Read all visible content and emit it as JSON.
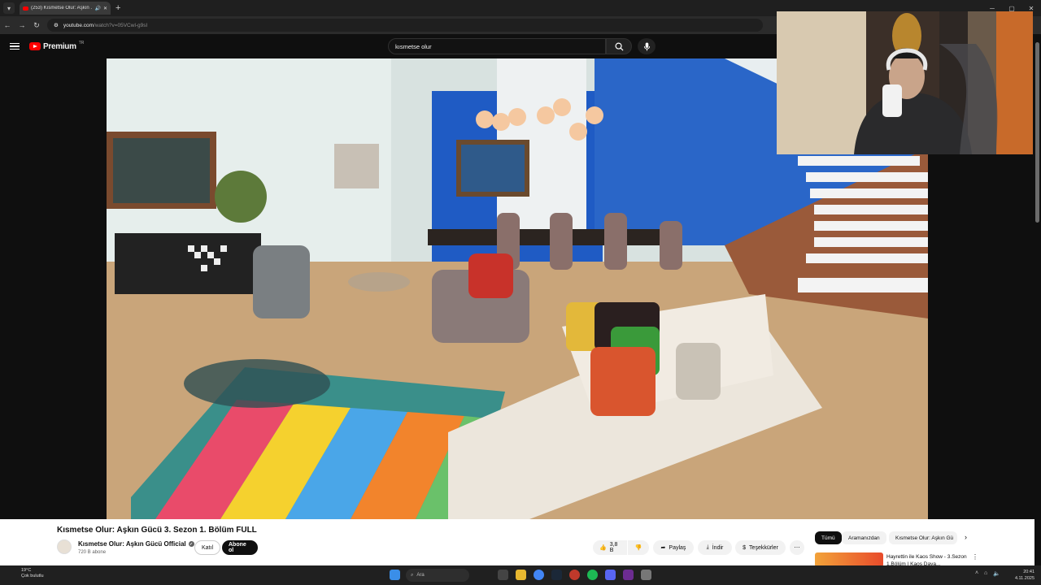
{
  "browser": {
    "tab_title": "(253) Kısmetse Olur: Aşkın ...",
    "url_host": "youtube.com",
    "url_path": "/watch?v=05VCwl-g9sI"
  },
  "youtube": {
    "logo_text": "Premium",
    "region": "TR",
    "search_value": "kısmetse olur"
  },
  "video": {
    "title": "Kısmetse Olur: Aşkın Gücü 3. Sezon 1. Bölüm FULL",
    "channel": "Kısmetse Olur: Aşkın Gücü Official",
    "subscribers": "720 B abone",
    "join_label": "Katıl",
    "subscribe_label": "Abone ol",
    "likes": "3,8 B",
    "share_label": "Paylaş",
    "download_label": "İndir",
    "thanks_label": "Teşekkürler"
  },
  "sidebar": {
    "chips": [
      "Tümü",
      "Aramanızdan",
      "Kısmetse Olur: Aşkın Gü"
    ],
    "rec_title": "Hayrettin ile Kaos Show - 3.Sezon 1.Bölüm | Kaos Dava..."
  },
  "taskbar": {
    "temp": "19°C",
    "weather": "Çok bulutlu",
    "search_placeholder": "Ara",
    "time": "20:41",
    "date": "4.11.2025"
  },
  "colors": {
    "youtube_red": "#ff0000",
    "dark_bg": "#0f0f0f"
  }
}
